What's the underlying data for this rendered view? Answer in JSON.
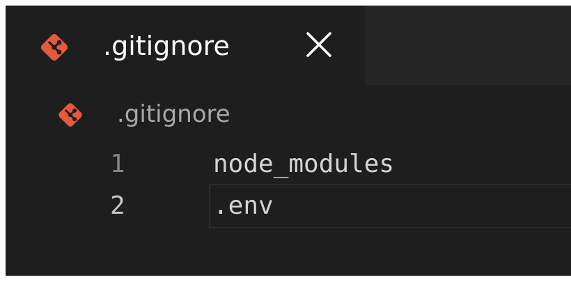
{
  "tab": {
    "label": ".gitignore",
    "icon": "git-icon",
    "close_icon": "close-icon"
  },
  "breadcrumb": {
    "label": ".gitignore",
    "icon": "git-icon"
  },
  "editor": {
    "lines": [
      {
        "number": "1",
        "text": "node_modules"
      },
      {
        "number": "2",
        "text": ".env"
      }
    ]
  },
  "colors": {
    "git_icon": "#e8593c",
    "editor_bg": "#1e1e1e",
    "tab_strip_bg": "#252526",
    "text": "#ffffff"
  }
}
